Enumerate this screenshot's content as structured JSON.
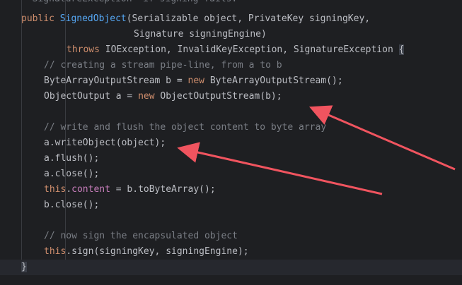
{
  "editor": {
    "top_fragment": "* SignatureException  if signing fails.",
    "lines": {
      "l1": {
        "kw": "public ",
        "name": "SignedObject",
        "rest": "(Serializable object, PrivateKey signingKey,"
      },
      "l2": {
        "text": "Signature signingEngine)"
      },
      "l3": {
        "kw": "throws ",
        "rest": "IOException, InvalidKeyException, SignatureException ",
        "brace": "{"
      },
      "l4": {
        "comment": "// creating a stream pipe-line, from a to b"
      },
      "l5": {
        "a": "ByteArrayOutputStream b = ",
        "kw": "new ",
        "b": "ByteArrayOutputStream();"
      },
      "l6": {
        "a": "ObjectOutput a = ",
        "kw": "new ",
        "b": "ObjectOutputStream(b);"
      },
      "l8": {
        "comment": "// write and flush the object content to byte array"
      },
      "l9": {
        "text": "a.writeObject(object);"
      },
      "l10": {
        "text": "a.flush();"
      },
      "l11": {
        "text": "a.close();"
      },
      "l12": {
        "this": "this",
        "dot": ".",
        "field": "content",
        "rest": " = b.toByteArray();"
      },
      "l13": {
        "text": "b.close();"
      },
      "l15": {
        "comment": "// now sign the encapsulated object"
      },
      "l16": {
        "this": "this",
        "rest": ".sign(signingKey, signingEngine);"
      },
      "l17": {
        "brace": "}"
      }
    }
  },
  "colors": {
    "background": "#1e1f22",
    "keyword": "#cf8e6d",
    "method_name": "#56a8f5",
    "comment": "#7a7e85",
    "field": "#c77dbb",
    "text": "#bcbec4",
    "annotation_arrow": "#f0545f"
  }
}
